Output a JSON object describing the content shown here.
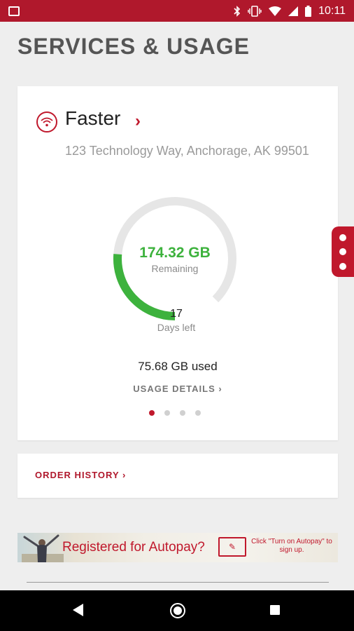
{
  "status_bar": {
    "time": "10:11",
    "icons": [
      "image-notification-icon",
      "bluetooth-icon",
      "vibrate-icon",
      "wifi-icon",
      "signal-icon",
      "battery-icon"
    ]
  },
  "page": {
    "title": "SERVICES & USAGE"
  },
  "service_card": {
    "service_name": "Faster",
    "address": "123 Technology Way, Anchorage, AK 99501",
    "gauge": {
      "remaining_value": "174.32 GB",
      "remaining_label": "Remaining",
      "remaining_fraction": 0.7,
      "days_left": "17",
      "days_left_label": "Days left"
    },
    "used": "75.68 GB used",
    "usage_details_label": "USAGE DETAILS",
    "pager": {
      "count": 4,
      "active_index": 0
    }
  },
  "order_history": {
    "label": "ORDER HISTORY"
  },
  "banner": {
    "headline": "Registered for Autopay?",
    "subtext": "Click \"Turn on Autopay\" to sign up."
  },
  "colors": {
    "brand": "#c0182c",
    "status_bar": "#b0182c",
    "gauge_fill": "#3db23d",
    "gauge_track": "#e6e6e6"
  }
}
